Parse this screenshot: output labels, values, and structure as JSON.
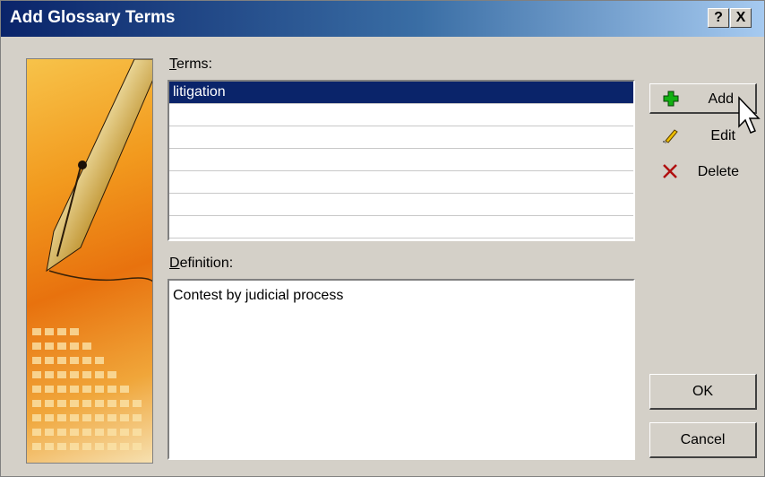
{
  "window": {
    "title": "Add Glossary Terms",
    "help_glyph": "?",
    "close_glyph": "X"
  },
  "terms": {
    "label_prefix": "",
    "label_accel": "T",
    "label_rest": "erms:",
    "items": [
      {
        "text": "litigation",
        "selected": true
      },
      {
        "text": ""
      },
      {
        "text": ""
      },
      {
        "text": ""
      },
      {
        "text": ""
      },
      {
        "text": ""
      },
      {
        "text": ""
      }
    ]
  },
  "definition": {
    "label_accel": "D",
    "label_rest": "efinition:",
    "value": "Contest by judicial process"
  },
  "actions": {
    "add_label": "Add",
    "edit_label": "Edit",
    "delete_label": "Delete"
  },
  "buttons": {
    "ok_label": "OK",
    "cancel_label": "Cancel"
  },
  "icons": {
    "add": "plus-icon",
    "edit": "pencil-icon",
    "delete": "x-icon",
    "cursor": "mouse-pointer-icon"
  },
  "colors": {
    "add_icon": "#12b012",
    "delete_icon": "#b01010",
    "selection": "#0a246a"
  }
}
